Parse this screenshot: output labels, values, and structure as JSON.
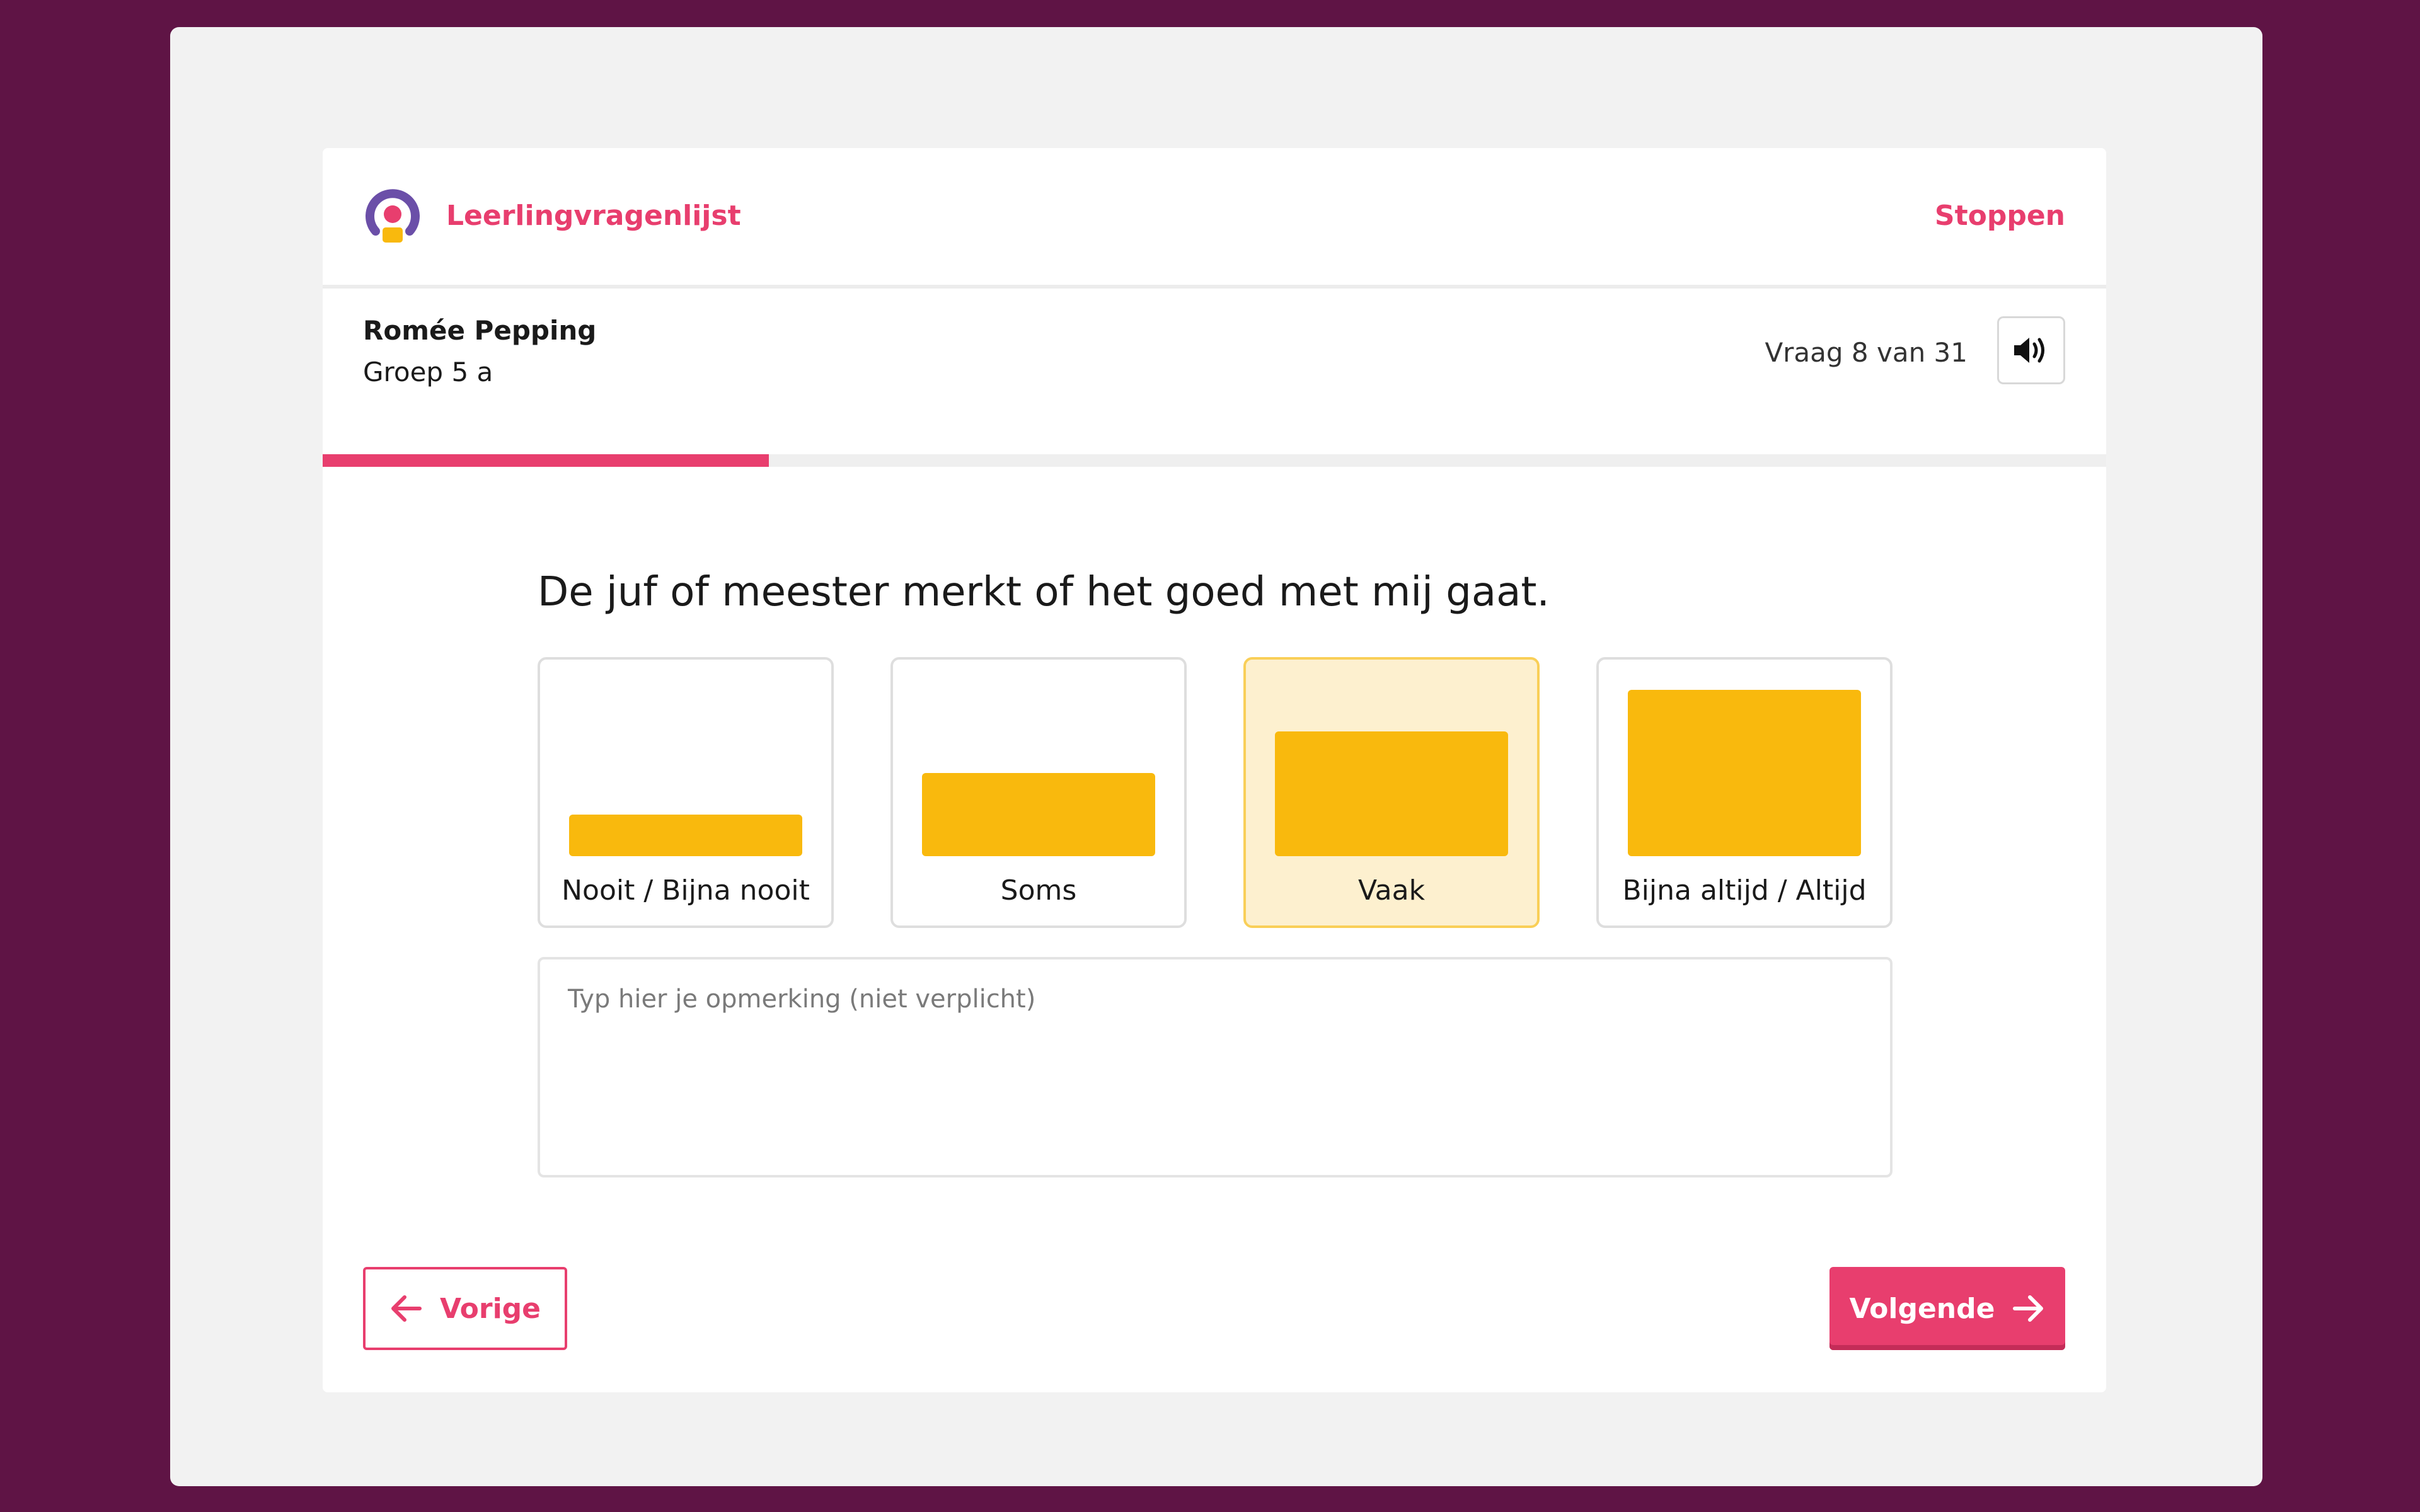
{
  "app": {
    "title": "Leerlingvragenlijst",
    "stop_label": "Stoppen",
    "logo_icon": "questionnaire-logo-icon"
  },
  "student": {
    "name": "Romée Pepping",
    "group": "Groep 5 a"
  },
  "progress": {
    "label": "Vraag 8 van 31",
    "current": 8,
    "total": 31,
    "fraction": 0.25,
    "audio_icon": "speaker-icon"
  },
  "question": {
    "text": "De juf of meester merkt of het goed met mij gaat.",
    "selected": "Vaak",
    "options": [
      {
        "label": "Nooit / Bijna nooit",
        "level": 0.25
      },
      {
        "label": "Soms",
        "level": 0.5
      },
      {
        "label": "Vaak",
        "level": 0.75
      },
      {
        "label": "Bijna altijd / Altijd",
        "level": 1.0
      }
    ]
  },
  "comment": {
    "placeholder": "Typ hier je opmerking (niet verplicht)",
    "value": ""
  },
  "navigation": {
    "prev_label": "Vorige",
    "next_label": "Volgende",
    "prev_icon": "arrow-left-icon",
    "next_icon": "arrow-right-icon"
  },
  "colors": {
    "accent": "#e83e6e",
    "background": "#5f1445",
    "bar": "#f9b90d",
    "selected_bg": "#fdf0cf",
    "logo_purple": "#6b4fa8"
  }
}
